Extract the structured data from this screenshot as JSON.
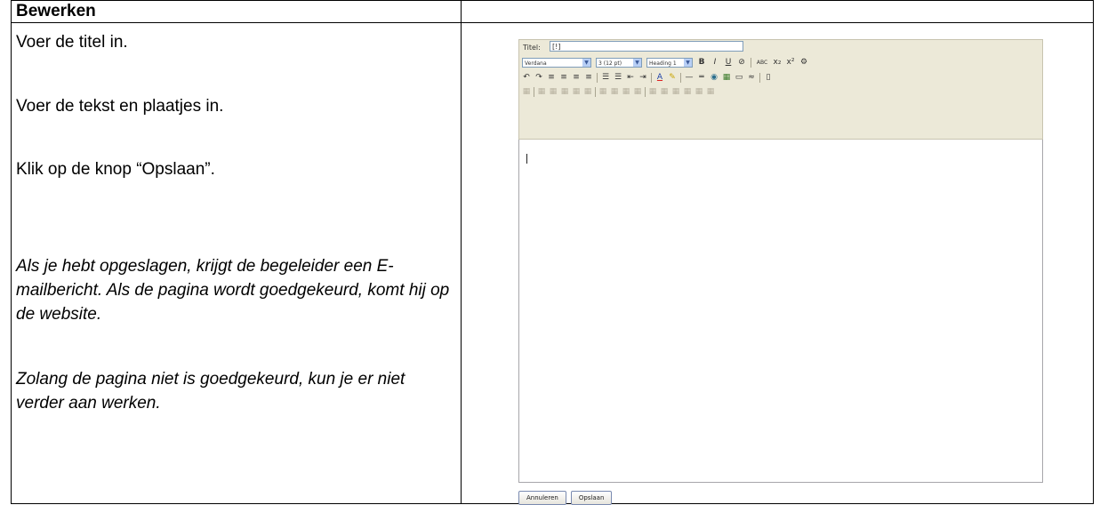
{
  "table": {
    "header_left": "Bewerken",
    "header_right": ""
  },
  "instructions": {
    "step1": "Voer de titel in.",
    "step2": "Voer de tekst en plaatjes in.",
    "step3": "Klik op de knop “Opslaan”.",
    "note1": "Als je hebt opgeslagen, krijgt de begeleider een E-mailbericht. Als de pagina wordt goedgekeurd, komt hij op de website.",
    "note2": "Zolang de pagina niet is goedgekeurd, kun je er niet verder aan werken."
  },
  "editor": {
    "title_label": "Titel:",
    "title_value": "[!]",
    "font_select": "Verdana",
    "size_select": "3 (12 pt)",
    "format_select": "Heading 1",
    "row1_buttons": [
      "B",
      "I",
      "U",
      "⊘",
      "ABC",
      "x₂",
      "x²",
      "⚙"
    ],
    "row2_buttons": [
      "↶",
      "↷",
      "≡",
      "≡",
      "≡",
      "≡",
      "☰",
      "☰",
      "⇤",
      "⇥",
      "A",
      "✎",
      "—",
      "═",
      "◉",
      "▦",
      "▭",
      "≈",
      "▯"
    ],
    "row3_buttons": [
      "▦",
      "▦",
      "▦",
      "▦",
      "▦",
      "▦",
      "▦",
      "▦",
      "▦",
      "▦",
      "▦",
      "▦",
      "▦",
      "▦",
      "▦",
      "▦"
    ],
    "cancel_button": "Annuleren",
    "save_button": "Opslaan"
  }
}
